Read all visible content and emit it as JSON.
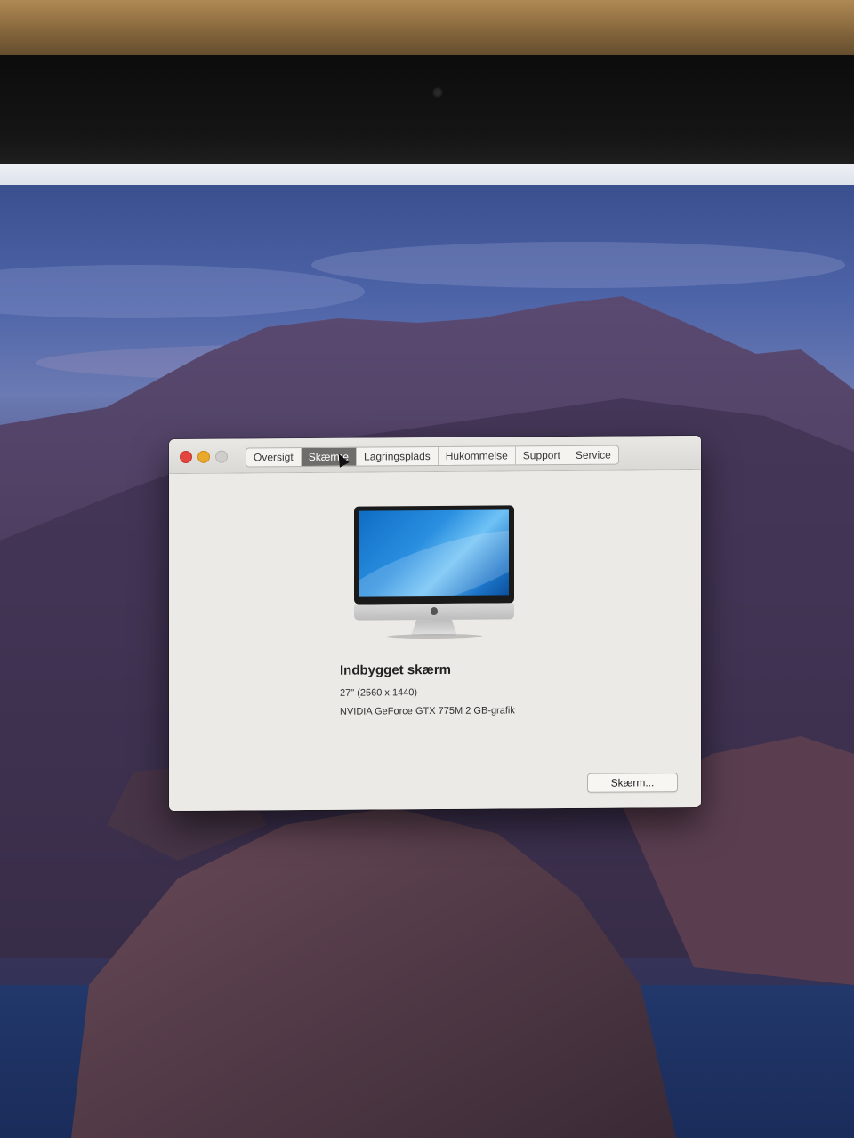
{
  "window": {
    "tabs": [
      {
        "label": "Oversigt",
        "active": false
      },
      {
        "label": "Skærme",
        "active": true
      },
      {
        "label": "Lagringsplads",
        "active": false
      },
      {
        "label": "Hukommelse",
        "active": false
      },
      {
        "label": "Support",
        "active": false
      },
      {
        "label": "Service",
        "active": false
      }
    ],
    "display": {
      "name": "Indbygget skærm",
      "size": "27\" (2560 x 1440)",
      "graphics": "NVIDIA GeForce GTX 775M 2 GB-grafik",
      "button_label": "Skærm..."
    }
  },
  "colors": {
    "close": "#e2463f",
    "minimize": "#e9a92a",
    "zoom_disabled": "#cfcecb",
    "active_tab": "#6e6d6a"
  }
}
